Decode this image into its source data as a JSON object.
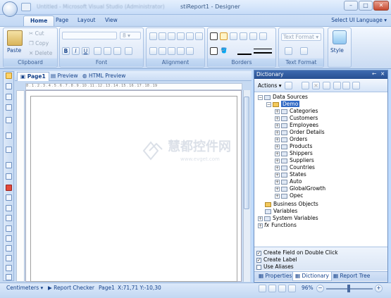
{
  "window": {
    "blurred_title": "Untitled - Microsoft Visual Studio (Administrator)",
    "title": "stiReport1 - Designer"
  },
  "ribbon": {
    "tabs": [
      "Home",
      "Page",
      "Layout",
      "View"
    ],
    "language_selector": "Select UI Language",
    "clipboard": {
      "label": "Clipboard",
      "paste": "Paste",
      "cut": "Cut",
      "copy": "Copy",
      "delete": "Delete"
    },
    "font": {
      "label": "Font",
      "size": "8",
      "bold": "B",
      "italic": "I",
      "underline": "U"
    },
    "alignment": {
      "label": "Alignment"
    },
    "borders": {
      "label": "Borders"
    },
    "text_format": {
      "label": "Text Format",
      "value": "Text Format"
    },
    "style": {
      "label": "Style"
    }
  },
  "document_tabs": [
    "Page1",
    "Preview",
    "HTML Preview"
  ],
  "ruler_text": "8 . 1 . 2 . 3 . 4 . 5 . 6 . 7 . 8 . 9 . 10 . 11 . 12 . 13 . 14 . 15 . 16 . 17 . 18 . 19",
  "dictionary": {
    "title": "Dictionary",
    "pin": "←",
    "close": "×",
    "actions": "Actions",
    "tree": {
      "data_sources": "Data Sources",
      "demo": "Demo",
      "tables": [
        "Categories",
        "Customers",
        "Employees",
        "Order Details",
        "Orders",
        "Products",
        "Shippers",
        "Suppliers",
        "Countries",
        "States",
        "Auto",
        "GlobalGrowth",
        "Opec"
      ],
      "business_objects": "Business Objects",
      "variables": "Variables",
      "system_variables": "System Variables",
      "functions": "Functions"
    },
    "options": [
      "Create Field on Double Click",
      "Create Label",
      "Use Aliases"
    ],
    "options_checked": [
      true,
      true,
      false
    ],
    "panel_tabs": [
      "Properties",
      "Dictionary",
      "Report Tree"
    ]
  },
  "statusbar": {
    "units": "Centimeters",
    "report_checker": "Report Checker",
    "page": "Page1",
    "coords": "X:71,71  Y:-10,30",
    "zoom": "96%"
  },
  "watermark": {
    "text": "慧都控件网",
    "url": "www.evget.com"
  }
}
